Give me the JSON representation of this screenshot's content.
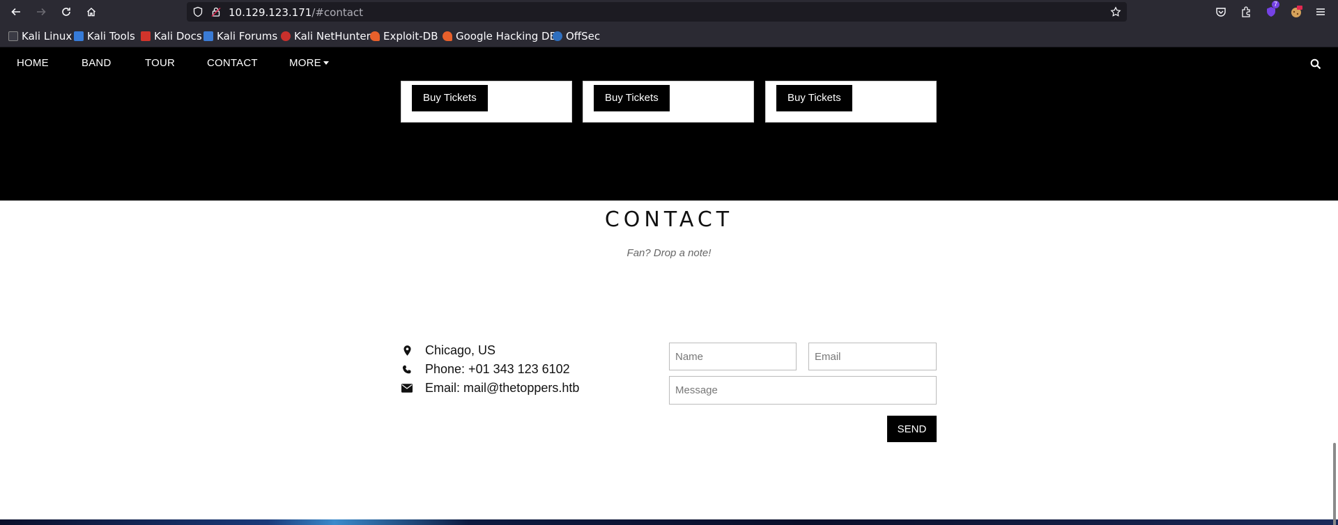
{
  "browser": {
    "url_host": "10.129.123.171",
    "url_path": "/#contact",
    "badge_count": "7",
    "bookmarks": [
      {
        "label": "Kali Linux",
        "color": "#2f6fbf"
      },
      {
        "label": "Kali Tools",
        "color": "#367bd8"
      },
      {
        "label": "Kali Docs",
        "color": "#d1342b"
      },
      {
        "label": "Kali Forums",
        "color": "#3a7bd5"
      },
      {
        "label": "Kali NetHunter",
        "color": "#c9302c"
      },
      {
        "label": "Exploit-DB",
        "color": "#e8602b"
      },
      {
        "label": "Google Hacking DB",
        "color": "#e8602b"
      },
      {
        "label": "OffSec",
        "color": "#2f6fbf"
      }
    ]
  },
  "site_nav": {
    "items": [
      "HOME",
      "BAND",
      "TOUR",
      "CONTACT",
      "MORE"
    ],
    "search_icon": "search-icon"
  },
  "tour": {
    "tickets": [
      {
        "label": "Buy Tickets"
      },
      {
        "label": "Buy Tickets"
      },
      {
        "label": "Buy Tickets"
      }
    ]
  },
  "contact": {
    "title": "CONTACT",
    "subtitle": "Fan? Drop a note!",
    "location": "Chicago, US",
    "phone": "Phone: +01 343 123 6102",
    "email": "Email: mail@thetoppers.htb",
    "name_placeholder": "Name",
    "email_placeholder": "Email",
    "message_placeholder": "Message",
    "send_label": "SEND"
  },
  "colors": {
    "chrome_bg": "#2b2a33",
    "url_bg": "#1c1b22",
    "nav_bg": "#000000",
    "button_bg": "#000000"
  }
}
